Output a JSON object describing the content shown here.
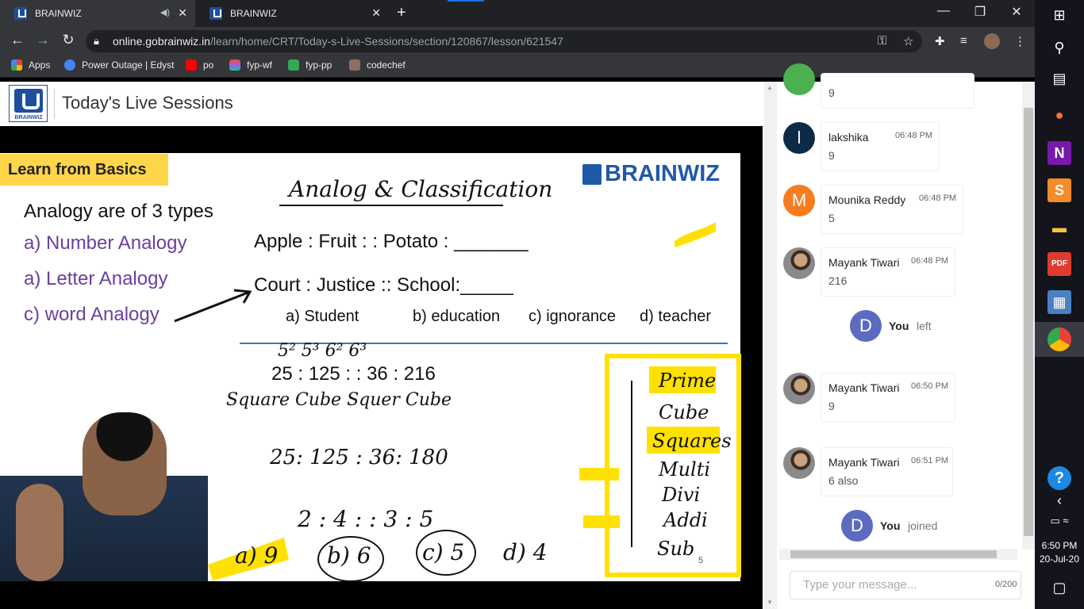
{
  "browser": {
    "tabs": [
      {
        "label": "BRAINWIZ",
        "active": true
      },
      {
        "label": "BRAINWIZ",
        "active": false
      }
    ],
    "url_host": "online.gobrainwiz.in",
    "url_path": "/learn/home/CRT/Today-s-Live-Sessions/section/120867/lesson/621547",
    "bookmarks": [
      {
        "label": "Apps",
        "color": "#ea4335"
      },
      {
        "label": "Power Outage | Edyst",
        "color": "#4285f4"
      },
      {
        "label": "po",
        "color": "#ff0000"
      },
      {
        "label": "fyp-wf",
        "color": "#f24e1e"
      },
      {
        "label": "fyp-pp",
        "color": "#34a853"
      },
      {
        "label": "codechef",
        "color": "#8d6e63"
      }
    ]
  },
  "page": {
    "title": "Today's Live Sessions",
    "logo_text": "BRAINWIZ"
  },
  "slide": {
    "banner": "Learn from Basics",
    "brand": "BRAINWIZ",
    "heading_handwritten": "Analog & Classification",
    "left_title": "Analogy are of 3 types",
    "types": [
      "a) Number Analogy",
      "a) Letter Analogy",
      "c) word Analogy"
    ],
    "q1": "Apple : Fruit : : Potato :  _______",
    "q2": "Court : Justice :: School:_____",
    "options": [
      "a) Student",
      "b) education",
      "c) ignorance",
      "d) teacher"
    ],
    "hw_series": "25 : 125 : : 36 : 216",
    "hw_powers": "5²  5³  6²  6³",
    "hw_words": "Square  Cube  Squer  Cube",
    "hw_series2": "25: 125 : 36: 180",
    "hw_series3": "2 : 4 : : 3 : 5",
    "hw_answers": [
      "a) 9",
      "b) 6",
      "c) 5",
      "d) 4"
    ],
    "hw_list": [
      "Prime",
      "Cube",
      "Squares",
      "Multi",
      "Divi",
      "Addi",
      "Sub"
    ],
    "page_number": "5"
  },
  "chat": {
    "messages": [
      {
        "type": "msg",
        "name": "",
        "time": "",
        "text": "9",
        "avatar": "",
        "color": "#4caf50"
      },
      {
        "type": "msg",
        "name": "lakshika",
        "time": "06:48 PM",
        "text": "9",
        "avatar": "l",
        "color": "#0d2b45"
      },
      {
        "type": "msg",
        "name": "Mounika Reddy",
        "time": "06:48 PM",
        "text": "5",
        "avatar": "M",
        "color": "#f57c1f"
      },
      {
        "type": "msg",
        "name": "Mayank Tiwari",
        "time": "06:48 PM",
        "text": "216",
        "avatar": "photo",
        "color": ""
      },
      {
        "type": "event",
        "name": "You",
        "text": "left",
        "avatar": "D",
        "color": "#5c6bc0"
      },
      {
        "type": "msg",
        "name": "Mayank Tiwari",
        "time": "06:50 PM",
        "text": "9",
        "avatar": "photo",
        "color": ""
      },
      {
        "type": "msg",
        "name": "Mayank Tiwari",
        "time": "06:51 PM",
        "text": "6 also",
        "avatar": "photo",
        "color": ""
      },
      {
        "type": "event",
        "name": "You",
        "text": "joined",
        "avatar": "D",
        "color": "#5c6bc0"
      }
    ],
    "input_placeholder": "Type your message...",
    "char_count": "0/200"
  },
  "taskbar": {
    "time": "6:50 PM",
    "date": "20-Jul-20"
  }
}
